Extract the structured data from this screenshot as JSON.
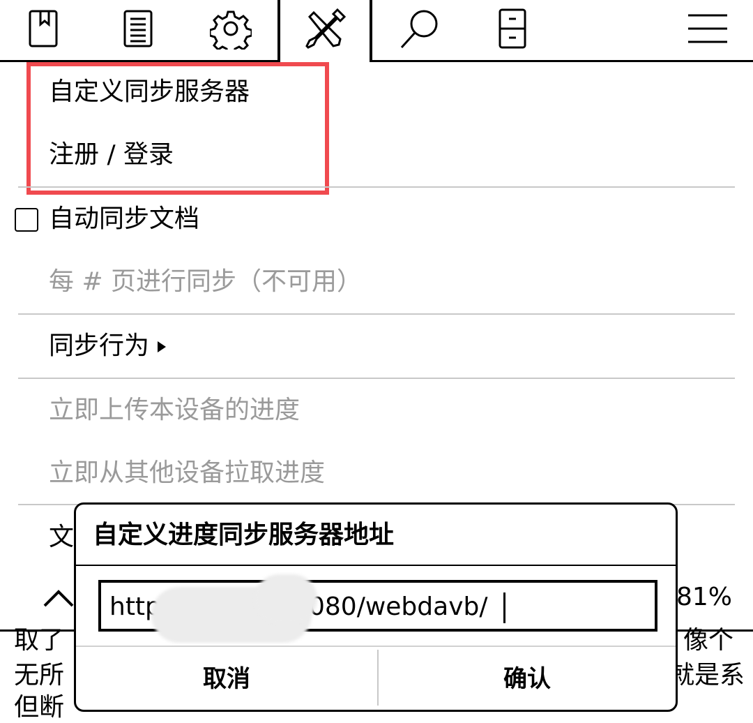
{
  "toolbar": {
    "icons": [
      "bookmark-icon",
      "toc-icon",
      "gear-icon",
      "tools-icon",
      "search-icon",
      "filing-cabinet-icon",
      "hamburger-menu-icon"
    ]
  },
  "menu": {
    "custom_server": "自定义同步服务器",
    "register_login": "注册 / 登录",
    "auto_sync": "自动同步文档",
    "sync_every_pages": "每 # 页进行同步（不可用）",
    "sync_behavior": "同步行为",
    "push_progress": "立即上传本设备的进度",
    "pull_progress": "立即从其他设备拉取进度",
    "partial_item": "文"
  },
  "footer": {
    "percent": "81%",
    "text_line1_left": "取了",
    "text_line1_right": "像个",
    "text_line2_left": "无所",
    "text_line2_right": "就是系",
    "text_line3_left": "但断"
  },
  "dialog": {
    "title": "自定义进度同步服务器地址",
    "input_prefix": "http",
    "input_suffix": "080/webdavb/",
    "cancel": "取消",
    "confirm": "确认"
  },
  "colors": {
    "highlight": "#f04a4f",
    "disabled_text": "#9a9a9a"
  }
}
